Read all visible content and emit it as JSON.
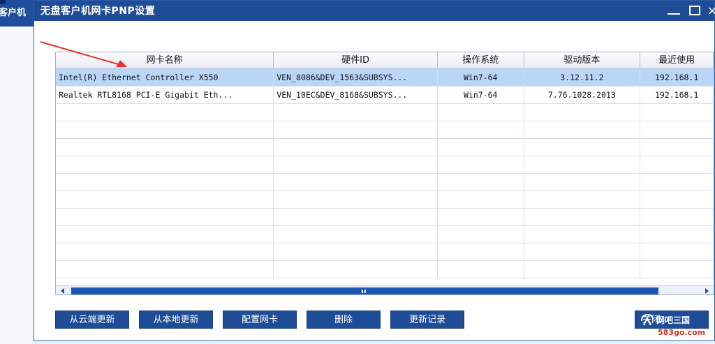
{
  "background": {
    "title_fragment": "客户机"
  },
  "dialog": {
    "title": "无盘客户机网卡PNP设置",
    "controls": {
      "minimize": "—",
      "maximize": "□",
      "close": "×"
    }
  },
  "grid": {
    "columns": [
      "网卡名称",
      "硬件ID",
      "操作系统",
      "驱动版本",
      "最近使用"
    ],
    "rows": [
      {
        "selected": true,
        "cells": [
          "Intel(R) Ethernet Controller X550",
          "VEN_8086&DEV_1563&SUBSYS...",
          "Win7-64",
          "3.12.11.2",
          "192.168.1"
        ]
      },
      {
        "selected": false,
        "cells": [
          "Realtek RTL8168 PCI-E Gigabit Eth...",
          "VEN_10EC&DEV_8168&SUBSYS...",
          "Win7-64",
          "7.76.1028.2013",
          "192.168.1"
        ]
      }
    ]
  },
  "buttons": {
    "update_cloud": "从云端更新",
    "update_local": "从本地更新",
    "config_nic": "配置网卡",
    "delete": "删除",
    "update_log": "更新记录",
    "close": "关闭"
  },
  "watermark": {
    "line1": "网吧三国",
    "line2": "583go.com"
  },
  "colors": {
    "titlebar": "#1e4c97",
    "selection": "#b9d6f7",
    "button": "#1e4c97",
    "annotation": "#e8352c"
  },
  "icons": [
    "minimize-icon",
    "maximize-icon",
    "close-icon",
    "scroll-left-icon",
    "scroll-right-icon",
    "annotation-arrow-icon"
  ]
}
